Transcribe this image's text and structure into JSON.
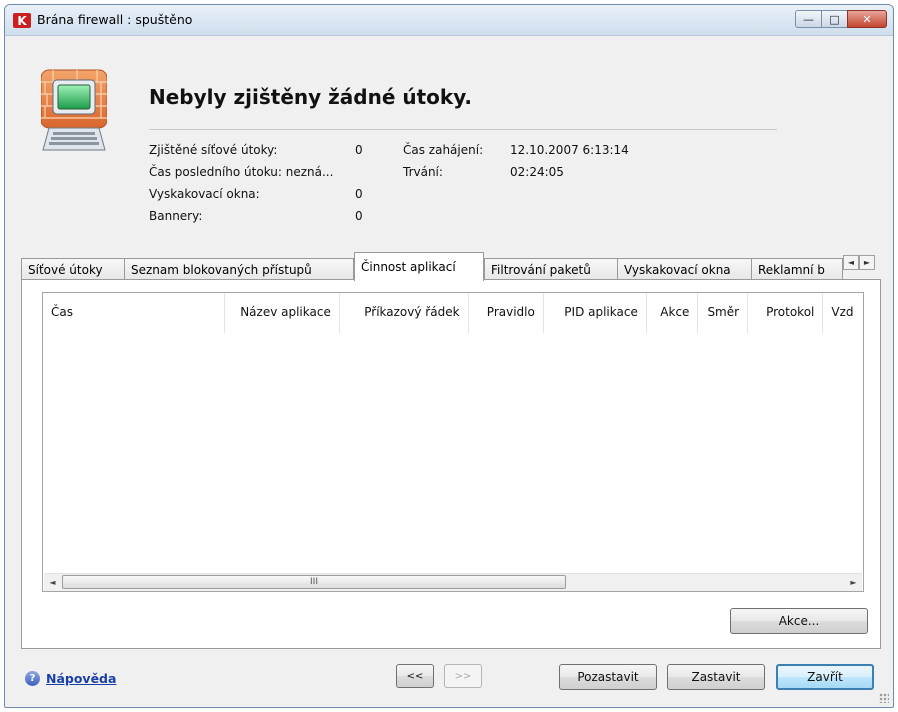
{
  "window": {
    "title": "Brána firewall : spuštěno",
    "app_icon_letter": "K",
    "controls": {
      "minimize": "—",
      "maximize": "□",
      "close": "✕"
    }
  },
  "header": {
    "headline": "Nebyly zjištěny žádné útoky.",
    "illustration": "firewall-computer-icon"
  },
  "stats": {
    "detected_attacks_label": "Zjištěné síťové útoky:",
    "detected_attacks_value": "0",
    "last_attack_label": "Čas posledního útoku: nezná...",
    "popups_label": "Vyskakovací okna:",
    "popups_value": "0",
    "banners_label": "Bannery:",
    "banners_value": "0",
    "start_time_label": "Čas zahájení:",
    "start_time_value": "12.10.2007 6:13:14",
    "duration_label": "Trvání:",
    "duration_value": "02:24:05"
  },
  "tabs": [
    {
      "label": "Síťové útoky"
    },
    {
      "label": "Seznam blokovaných přístupů"
    },
    {
      "label": "Činnost aplikací",
      "active": true
    },
    {
      "label": "Filtrování paketů"
    },
    {
      "label": "Vyskakovací okna"
    },
    {
      "label": "Reklamní b"
    }
  ],
  "tab_scroll": {
    "left": "◄",
    "right": "►"
  },
  "table": {
    "columns": [
      "Čas",
      "Název aplikace",
      "Příkazový řádek",
      "Pravidlo",
      "PID aplikace",
      "Akce",
      "Směr",
      "Protokol",
      "Vzd"
    ],
    "rows": []
  },
  "scrollbar": {
    "left": "◄",
    "right": "►",
    "grip": "III"
  },
  "buttons": {
    "actions": "Akce...",
    "prev": "<<",
    "next": ">>",
    "pause": "Pozastavit",
    "stop": "Zastavit",
    "close": "Zavřít"
  },
  "help": {
    "icon": "?",
    "label": "Nápověda"
  },
  "colors": {
    "accent": "#3c7fb1",
    "link": "#1a3fa8",
    "brand": "#cc1f1f"
  }
}
